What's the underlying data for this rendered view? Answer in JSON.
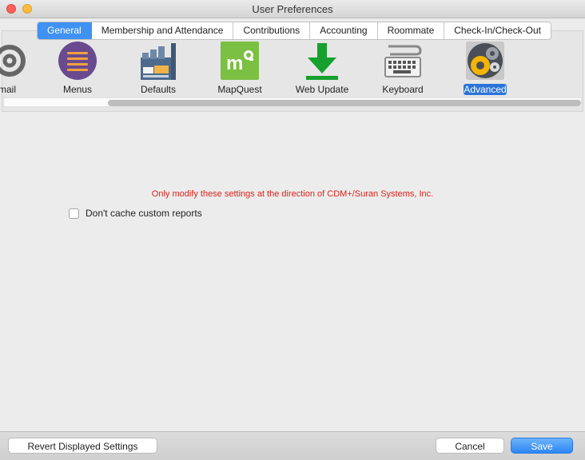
{
  "window": {
    "title": "User Preferences"
  },
  "tabs": [
    {
      "label": "General",
      "active": true
    },
    {
      "label": "Membership and Attendance"
    },
    {
      "label": "Contributions"
    },
    {
      "label": "Accounting"
    },
    {
      "label": "Roommate"
    },
    {
      "label": "Check-In/Check-Out"
    }
  ],
  "toolbar": [
    {
      "label": "mail",
      "icon": "email-icon"
    },
    {
      "label": "Menus",
      "icon": "menus-icon"
    },
    {
      "label": "Defaults",
      "icon": "defaults-icon"
    },
    {
      "label": "MapQuest",
      "icon": "mapquest-icon"
    },
    {
      "label": "Web Update",
      "icon": "web-update-icon"
    },
    {
      "label": "Keyboard",
      "icon": "keyboard-icon"
    },
    {
      "label": "Advanced",
      "icon": "advanced-gears-icon",
      "selected": true
    }
  ],
  "content": {
    "warning": "Only modify these settings at the direction of CDM+/Suran Systems, Inc.",
    "checkbox_label": "Don't cache custom reports",
    "checkbox_checked": false
  },
  "buttons": {
    "revert": "Revert Displayed Settings",
    "cancel": "Cancel",
    "save": "Save"
  },
  "colors": {
    "accent": "#2a74d8",
    "warning": "#e0211b"
  }
}
